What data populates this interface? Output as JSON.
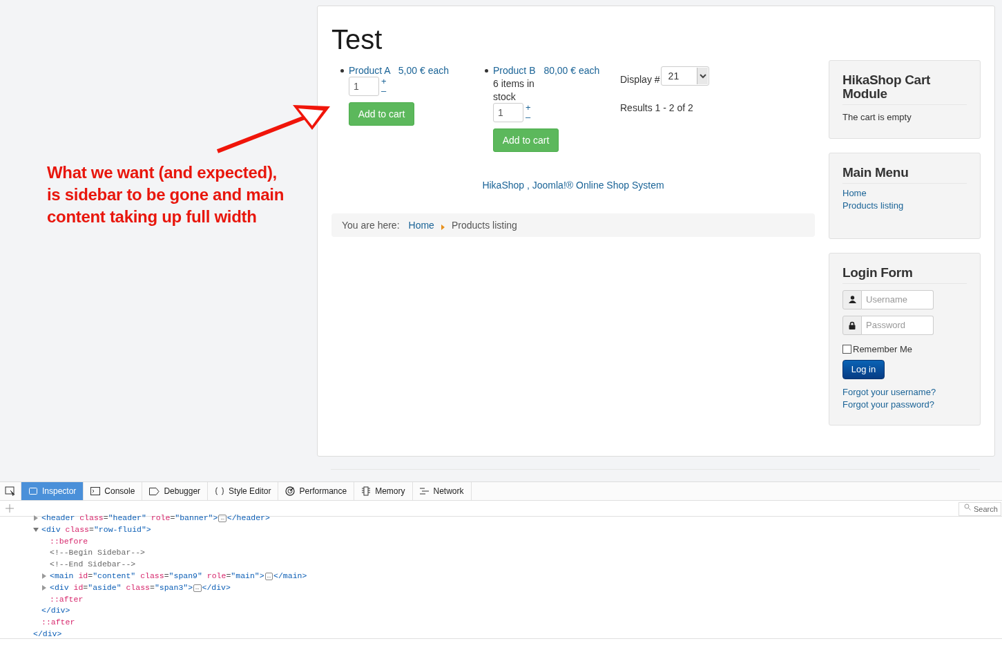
{
  "annotation": {
    "text": "What we want (and expected), is sidebar to be gone and main content taking up full width"
  },
  "page_title": "Test",
  "products": [
    {
      "name": "Product A",
      "price": "5,00 € each",
      "quantity": "1",
      "plus": "+",
      "minus": "–",
      "button": "Add to cart"
    },
    {
      "name": "Product B",
      "price": "80,00 € each",
      "stock": "6 items in stock",
      "quantity": "1",
      "plus": "+",
      "minus": "–",
      "button": "Add to cart"
    }
  ],
  "display": {
    "label": "Display #",
    "value": "21"
  },
  "results": "Results 1 - 2 of 2",
  "footer_link": "HikaShop , Joomla!® Online Shop System",
  "breadcrumb": {
    "label": "You are here:",
    "items": [
      {
        "text": "Home",
        "link": true
      },
      {
        "text": "Products listing",
        "link": false
      }
    ]
  },
  "sidebar": [
    {
      "kind": "text",
      "title": "HikaShop Cart Module",
      "text": "The cart is empty"
    },
    {
      "kind": "menu",
      "title": "Main Menu",
      "items": [
        "Home",
        "Products listing"
      ]
    },
    {
      "kind": "login",
      "title": "Login Form",
      "username_placeholder": "Username",
      "password_placeholder": "Password",
      "remember": {
        "label": "Remember Me",
        "checked": false
      },
      "button": "Log in",
      "links": [
        "Forgot your username?",
        "Forgot your password?"
      ]
    }
  ],
  "devtools": {
    "tabs": [
      {
        "kind": "inspector",
        "label": "Inspector",
        "selected": true
      },
      {
        "kind": "console",
        "label": "Console",
        "selected": false
      },
      {
        "kind": "debugger",
        "label": "Debugger",
        "selected": false
      },
      {
        "kind": "style",
        "label": "Style Editor",
        "selected": false
      },
      {
        "kind": "performance",
        "label": "Performance",
        "selected": false
      },
      {
        "kind": "memory",
        "label": "Memory",
        "selected": false
      },
      {
        "kind": "network",
        "label": "Network",
        "selected": false
      }
    ],
    "search": {
      "placeholder": "Search"
    },
    "tree": {
      "close": [
        {
          "kind": "tag",
          "text": "</div>"
        }
      ],
      "children": [
        {
          "expanded": false,
          "tokens": [
            {
              "kind": "tag",
              "text": "<header"
            },
            {
              "kind": "attr",
              "text": " class"
            },
            {
              "kind": "plain",
              "text": "="
            },
            {
              "kind": "value",
              "text": "\"header\""
            },
            {
              "kind": "attr",
              "text": " role"
            },
            {
              "kind": "plain",
              "text": "="
            },
            {
              "kind": "value",
              "text": "\"banner\""
            },
            {
              "kind": "tag",
              "text": ">"
            },
            {
              "kind": "badge",
              "text": "…"
            },
            {
              "kind": "tag",
              "text": "</header>"
            }
          ]
        },
        {
          "expanded": true,
          "tokens": [
            {
              "kind": "tag",
              "text": "<div"
            },
            {
              "kind": "attr",
              "text": " class"
            },
            {
              "kind": "plain",
              "text": "="
            },
            {
              "kind": "value",
              "text": "\"row-fluid\""
            },
            {
              "kind": "tag",
              "text": ">"
            }
          ],
          "close": [
            {
              "kind": "tag",
              "text": "</div>"
            }
          ],
          "children": [
            {
              "tokens": [
                {
                  "kind": "pseudo",
                  "text": "::before"
                }
              ]
            },
            {
              "tokens": [
                {
                  "kind": "comment",
                  "text": "<!--Begin Sidebar-->"
                }
              ]
            },
            {
              "tokens": [
                {
                  "kind": "comment",
                  "text": "<!--End Sidebar-->"
                }
              ]
            },
            {
              "expanded": false,
              "tokens": [
                {
                  "kind": "tag",
                  "text": "<main"
                },
                {
                  "kind": "attr",
                  "text": " id"
                },
                {
                  "kind": "plain",
                  "text": "="
                },
                {
                  "kind": "value",
                  "text": "\"content\""
                },
                {
                  "kind": "attr",
                  "text": " class"
                },
                {
                  "kind": "plain",
                  "text": "="
                },
                {
                  "kind": "value",
                  "text": "\"span9\""
                },
                {
                  "kind": "attr",
                  "text": " role"
                },
                {
                  "kind": "plain",
                  "text": "="
                },
                {
                  "kind": "value",
                  "text": "\"main\""
                },
                {
                  "kind": "tag",
                  "text": ">"
                },
                {
                  "kind": "badge",
                  "text": "…"
                },
                {
                  "kind": "tag",
                  "text": "</main>"
                }
              ]
            },
            {
              "expanded": false,
              "tokens": [
                {
                  "kind": "tag",
                  "text": "<div"
                },
                {
                  "kind": "attr",
                  "text": " id"
                },
                {
                  "kind": "plain",
                  "text": "="
                },
                {
                  "kind": "value",
                  "text": "\"aside\""
                },
                {
                  "kind": "attr",
                  "text": " class"
                },
                {
                  "kind": "plain",
                  "text": "="
                },
                {
                  "kind": "value",
                  "text": "\"span3\""
                },
                {
                  "kind": "tag",
                  "text": ">"
                },
                {
                  "kind": "badge",
                  "text": "…"
                },
                {
                  "kind": "tag",
                  "text": "</div>"
                }
              ]
            },
            {
              "tokens": [
                {
                  "kind": "pseudo",
                  "text": "::after"
                }
              ]
            }
          ]
        },
        {
          "tokens": [
            {
              "kind": "pseudo",
              "text": "::after"
            }
          ]
        }
      ]
    }
  }
}
